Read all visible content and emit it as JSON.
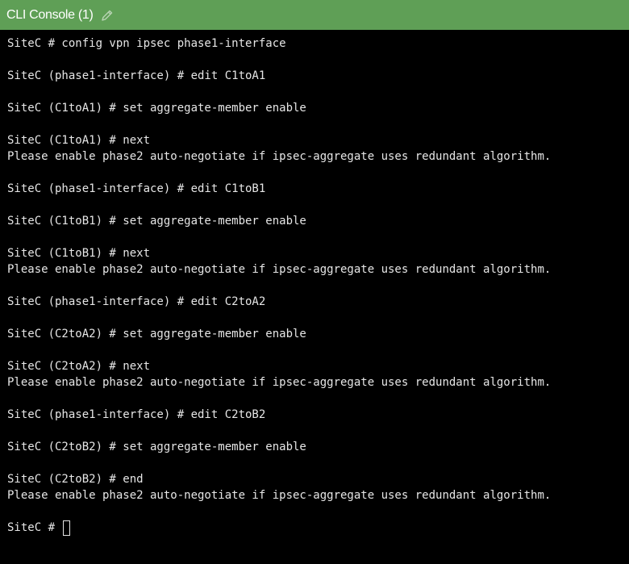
{
  "window": {
    "title": "CLI Console (1)",
    "edit_icon": "pencil-icon",
    "accent_color": "#5f9f56"
  },
  "console": {
    "lines": [
      "SiteC # config vpn ipsec phase1-interface",
      "",
      "SiteC (phase1-interface) # edit C1toA1",
      "",
      "SiteC (C1toA1) # set aggregate-member enable",
      "",
      "SiteC (C1toA1) # next",
      "Please enable phase2 auto-negotiate if ipsec-aggregate uses redundant algorithm.",
      "",
      "SiteC (phase1-interface) # edit C1toB1",
      "",
      "SiteC (C1toB1) # set aggregate-member enable",
      "",
      "SiteC (C1toB1) # next",
      "Please enable phase2 auto-negotiate if ipsec-aggregate uses redundant algorithm.",
      "",
      "SiteC (phase1-interface) # edit C2toA2",
      "",
      "SiteC (C2toA2) # set aggregate-member enable",
      "",
      "SiteC (C2toA2) # next",
      "Please enable phase2 auto-negotiate if ipsec-aggregate uses redundant algorithm.",
      "",
      "SiteC (phase1-interface) # edit C2toB2",
      "",
      "SiteC (C2toB2) # set aggregate-member enable",
      "",
      "SiteC (C2toB2) # end",
      "Please enable phase2 auto-negotiate if ipsec-aggregate uses redundant algorithm.",
      ""
    ],
    "prompt": "SiteC # "
  }
}
